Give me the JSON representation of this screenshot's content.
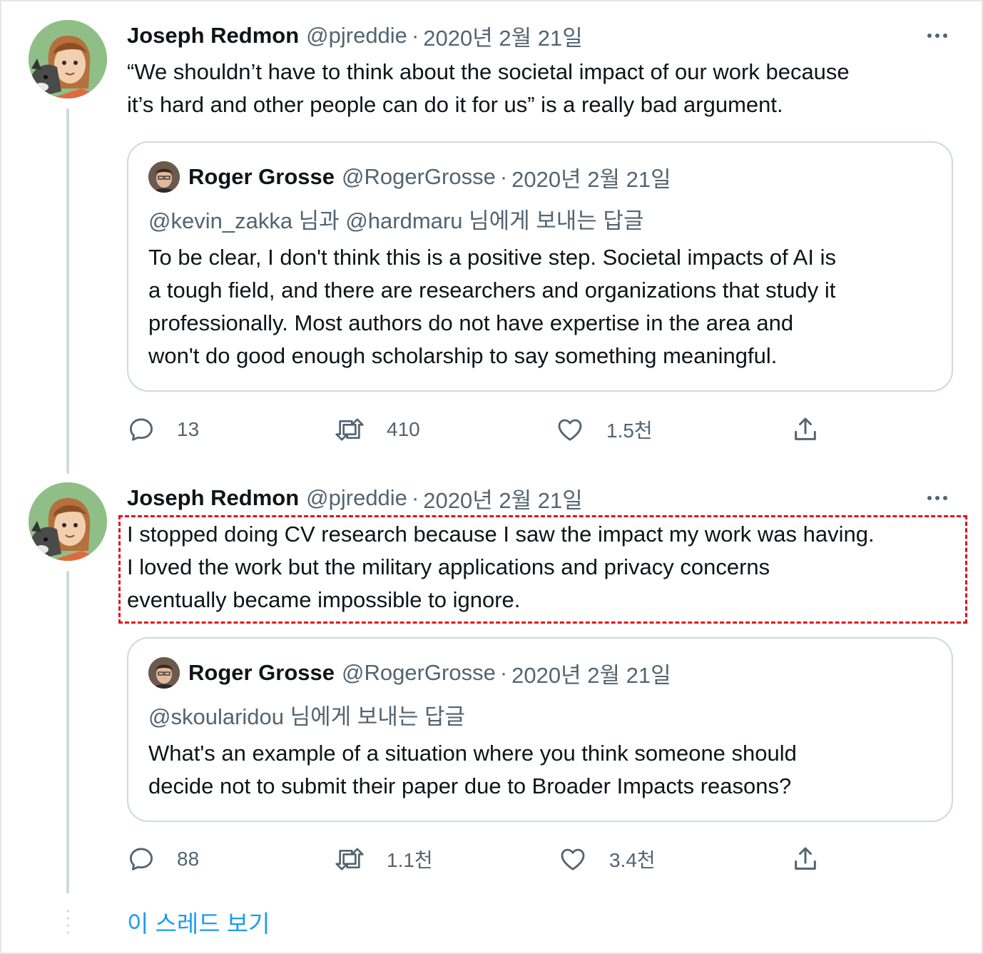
{
  "tweets": [
    {
      "author": "Joseph Redmon",
      "handle": "@pjreddie",
      "separator": "·",
      "date": "2020년 2월 21일",
      "text_lines": [
        "“We shouldn’t have to think about the societal impact of our work because",
        "it’s hard and other people can do it for us” is a really bad argument."
      ],
      "quote": {
        "author": "Roger Grosse",
        "handle": "@RogerGrosse",
        "separator": "·",
        "date": "2020년 2월 21일",
        "reply_to": "@kevin_zakka 님과 @hardmaru 님에게 보내는 답글",
        "text_lines": [
          "To be clear, I don't think this is a positive step. Societal impacts of AI is",
          "a tough field, and there are researchers and organizations that study it",
          "professionally. Most authors do not have expertise in the area and",
          "won't do good enough scholarship to say something meaningful."
        ]
      },
      "stats": {
        "replies": "13",
        "retweets": "410",
        "likes": "1.5천"
      }
    },
    {
      "author": "Joseph Redmon",
      "handle": "@pjreddie",
      "separator": "·",
      "date": "2020년 2월 21일",
      "text_lines": [
        "I stopped doing CV research because I saw the impact my work was having.",
        "I loved the work but the military applications and privacy concerns",
        "eventually became impossible to ignore."
      ],
      "quote": {
        "author": "Roger Grosse",
        "handle": "@RogerGrosse",
        "separator": "·",
        "date": "2020년 2월 21일",
        "reply_to": "@skoularidou 님에게 보내는 답글",
        "text_lines": [
          "What's an example of a situation where you think someone should",
          "decide not to submit their paper due to Broader Impacts reasons?"
        ]
      },
      "stats": {
        "replies": "88",
        "retweets": "1.1천",
        "likes": "3.4천"
      }
    }
  ],
  "show_thread_label": "이 스레드 보기",
  "icons": {
    "reply": "reply-icon",
    "retweet": "retweet-icon",
    "like": "heart-icon",
    "share": "share-icon",
    "more": "more-options-icon"
  },
  "colors": {
    "text": "#0f1419",
    "secondary": "#536471",
    "link": "#1d9bf0",
    "border": "#cfd9de",
    "highlight": "#e0141e"
  }
}
